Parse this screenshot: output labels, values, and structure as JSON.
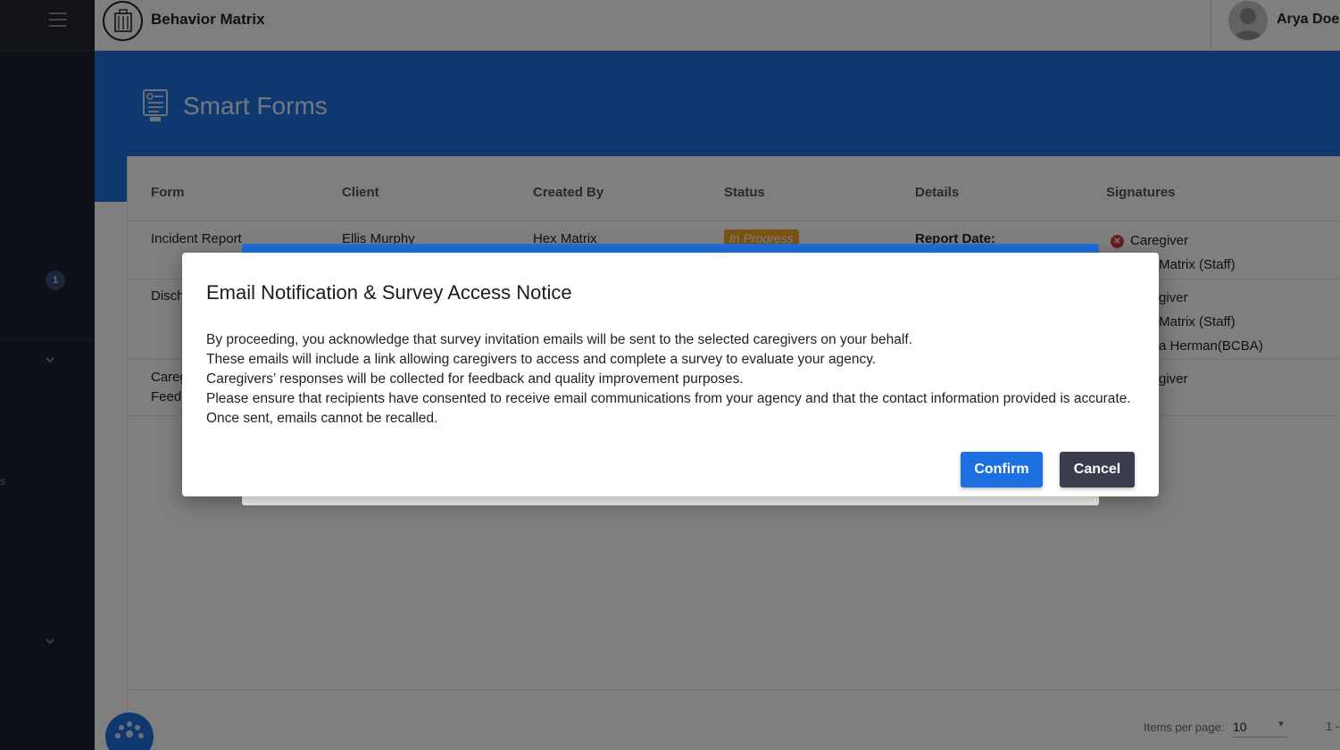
{
  "app": {
    "title": "Behavior Matrix"
  },
  "user": {
    "name": "Arya Doe"
  },
  "sidebar": {
    "badge_count": "1",
    "side_mark": "s"
  },
  "page": {
    "title": "Smart Forms"
  },
  "table": {
    "columns": [
      "Form",
      "Client",
      "Created By",
      "Status",
      "Details",
      "Signatures"
    ],
    "row1": {
      "form": "Incident Report",
      "client": "Ellis Murphy",
      "created_by": "Hex Matrix",
      "status": "In Progress",
      "details": "Report Date:",
      "sig1": "Caregiver",
      "sig2": "Matrix (Staff)"
    },
    "row2": {
      "form": "Disch",
      "sig1": "giver",
      "sig2": "Matrix (Staff)",
      "sig3": "a Herman(BCBA)"
    },
    "row3": {
      "form_line1": "Careg",
      "form_line2": "Feed",
      "sig1": "giver"
    }
  },
  "pagination": {
    "items_per_page_label": "Items per page:",
    "items_per_page_value": "10",
    "range": "1 -"
  },
  "modal": {
    "title": "Email Notification & Survey Access Notice",
    "lines": [
      "By proceeding, you acknowledge that survey invitation emails will be sent to the selected caregivers on your behalf.",
      "These emails will include a link allowing caregivers to access and complete a survey to evaluate your agency.",
      "Caregivers’ responses will be collected for feedback and quality improvement purposes.",
      "Please ensure that recipients have consented to receive email communications from your agency and that the contact information provided is accurate.",
      "Once sent, emails cannot be recalled."
    ],
    "confirm_label": "Confirm",
    "cancel_label": "Cancel"
  },
  "colors": {
    "primary": "#1e6fe0",
    "sidebar": "#1f2233",
    "status_in_progress": "#f5a623",
    "error": "#d83b3b",
    "cancel_button": "#3a3d4d"
  }
}
